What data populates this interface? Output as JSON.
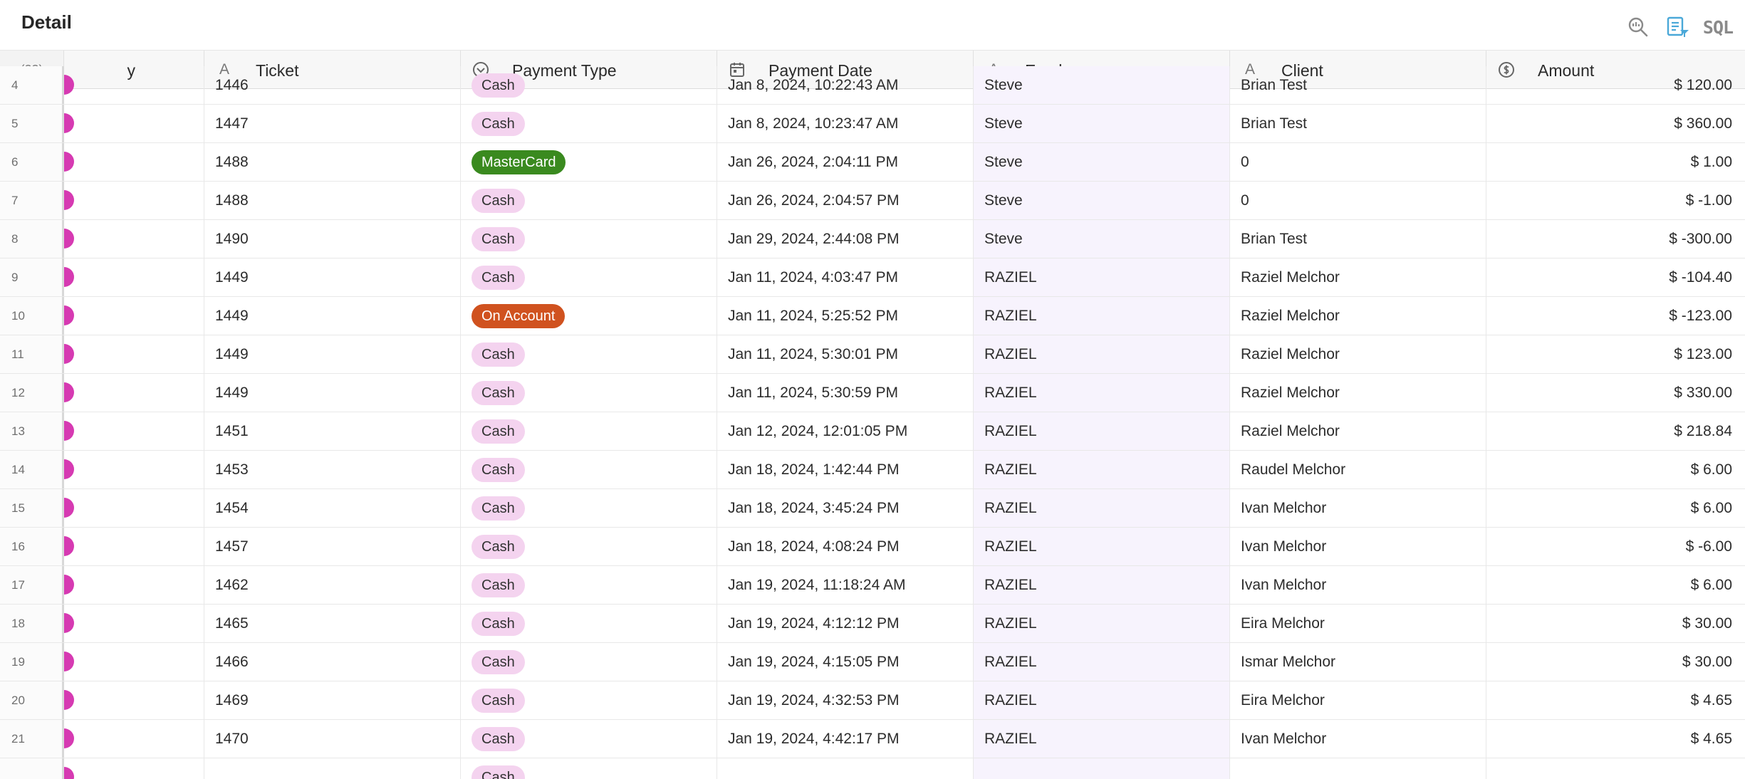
{
  "header": {
    "title": "Detail",
    "tools": [
      "search-refresh-icon",
      "report-filter-icon",
      "sql-button"
    ],
    "sql_label": "SQL"
  },
  "grid": {
    "rowcount_label": "(23)",
    "clipped_column_label": "y",
    "columns": [
      {
        "key": "ticket",
        "label": "Ticket",
        "icon": "text-type-icon"
      },
      {
        "key": "ptype",
        "label": "Payment Type",
        "icon": "select-type-icon"
      },
      {
        "key": "pdate",
        "label": "Payment Date",
        "icon": "calendar-icon"
      },
      {
        "key": "emp",
        "label": "Employee",
        "icon": "text-type-icon"
      },
      {
        "key": "client",
        "label": "Client",
        "icon": "text-type-icon"
      },
      {
        "key": "amount",
        "label": "Amount",
        "icon": "currency-icon"
      }
    ],
    "payment_type_colors": {
      "Cash": "#f4d3ef",
      "MasterCard": "#3a8a1f",
      "On Account": "#d0521f"
    },
    "rows": [
      {
        "n": "4",
        "ticket": "1446",
        "ptype": "Cash",
        "pdate": "Jan 8, 2024, 10:22:43 AM",
        "emp": "Steve",
        "client": "Brian Test",
        "amount": "$ 120.00"
      },
      {
        "n": "5",
        "ticket": "1447",
        "ptype": "Cash",
        "pdate": "Jan 8, 2024, 10:23:47 AM",
        "emp": "Steve",
        "client": "Brian Test",
        "amount": "$ 360.00"
      },
      {
        "n": "6",
        "ticket": "1488",
        "ptype": "MasterCard",
        "pdate": "Jan 26, 2024, 2:04:11 PM",
        "emp": "Steve",
        "client": "0",
        "amount": "$ 1.00"
      },
      {
        "n": "7",
        "ticket": "1488",
        "ptype": "Cash",
        "pdate": "Jan 26, 2024, 2:04:57 PM",
        "emp": "Steve",
        "client": "0",
        "amount": "$ -1.00"
      },
      {
        "n": "8",
        "ticket": "1490",
        "ptype": "Cash",
        "pdate": "Jan 29, 2024, 2:44:08 PM",
        "emp": "Steve",
        "client": "Brian Test",
        "amount": "$ -300.00"
      },
      {
        "n": "9",
        "ticket": "1449",
        "ptype": "Cash",
        "pdate": "Jan 11, 2024, 4:03:47 PM",
        "emp": "RAZIEL",
        "client": "Raziel Melchor",
        "amount": "$ -104.40"
      },
      {
        "n": "10",
        "ticket": "1449",
        "ptype": "On Account",
        "pdate": "Jan 11, 2024, 5:25:52 PM",
        "emp": "RAZIEL",
        "client": "Raziel Melchor",
        "amount": "$ -123.00"
      },
      {
        "n": "11",
        "ticket": "1449",
        "ptype": "Cash",
        "pdate": "Jan 11, 2024, 5:30:01 PM",
        "emp": "RAZIEL",
        "client": "Raziel Melchor",
        "amount": "$ 123.00"
      },
      {
        "n": "12",
        "ticket": "1449",
        "ptype": "Cash",
        "pdate": "Jan 11, 2024, 5:30:59 PM",
        "emp": "RAZIEL",
        "client": "Raziel Melchor",
        "amount": "$ 330.00"
      },
      {
        "n": "13",
        "ticket": "1451",
        "ptype": "Cash",
        "pdate": "Jan 12, 2024, 12:01:05 PM",
        "emp": "RAZIEL",
        "client": "Raziel Melchor",
        "amount": "$ 218.84"
      },
      {
        "n": "14",
        "ticket": "1453",
        "ptype": "Cash",
        "pdate": "Jan 18, 2024, 1:42:44 PM",
        "emp": "RAZIEL",
        "client": "Raudel Melchor",
        "amount": "$ 6.00"
      },
      {
        "n": "15",
        "ticket": "1454",
        "ptype": "Cash",
        "pdate": "Jan 18, 2024, 3:45:24 PM",
        "emp": "RAZIEL",
        "client": "Ivan Melchor",
        "amount": "$ 6.00"
      },
      {
        "n": "16",
        "ticket": "1457",
        "ptype": "Cash",
        "pdate": "Jan 18, 2024, 4:08:24 PM",
        "emp": "RAZIEL",
        "client": "Ivan Melchor",
        "amount": "$ -6.00"
      },
      {
        "n": "17",
        "ticket": "1462",
        "ptype": "Cash",
        "pdate": "Jan 19, 2024, 11:18:24 AM",
        "emp": "RAZIEL",
        "client": "Ivan Melchor",
        "amount": "$ 6.00"
      },
      {
        "n": "18",
        "ticket": "1465",
        "ptype": "Cash",
        "pdate": "Jan 19, 2024, 4:12:12 PM",
        "emp": "RAZIEL",
        "client": "Eira Melchor",
        "amount": "$ 30.00"
      },
      {
        "n": "19",
        "ticket": "1466",
        "ptype": "Cash",
        "pdate": "Jan 19, 2024, 4:15:05 PM",
        "emp": "RAZIEL",
        "client": "Ismar Melchor",
        "amount": "$ 30.00"
      },
      {
        "n": "20",
        "ticket": "1469",
        "ptype": "Cash",
        "pdate": "Jan 19, 2024, 4:32:53 PM",
        "emp": "RAZIEL",
        "client": "Eira Melchor",
        "amount": "$ 4.65"
      },
      {
        "n": "21",
        "ticket": "1470",
        "ptype": "Cash",
        "pdate": "Jan 19, 2024, 4:42:17 PM",
        "emp": "RAZIEL",
        "client": "Ivan Melchor",
        "amount": "$ 4.65"
      },
      {
        "n": "",
        "ticket": "",
        "ptype": "Cash",
        "pdate": "",
        "emp": "",
        "client": "",
        "amount": ""
      }
    ]
  }
}
